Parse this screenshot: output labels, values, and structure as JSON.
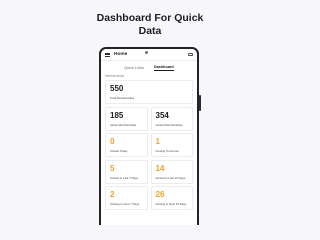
{
  "headline": {
    "line1": "Dashboard For Quick",
    "line2": "Data"
  },
  "app": {
    "title": "Home"
  },
  "tabs": [
    {
      "label": "Quick Links"
    },
    {
      "label": "Dashboard"
    }
  ],
  "section": {
    "label": "Memberships"
  },
  "stats": {
    "total": {
      "value": "550",
      "label": "Total Memberships"
    },
    "active": {
      "value": "185",
      "label": "Active Memberships"
    },
    "closed": {
      "value": "354",
      "label": "Closed Memberships"
    },
    "closed_today": {
      "value": "0",
      "label": "Closed Today"
    },
    "closing_tomorrow": {
      "value": "1",
      "label": "Closing Tomorrow"
    },
    "closed_last7": {
      "value": "5",
      "label": "Closed in Last 7 Days"
    },
    "closed_last15": {
      "value": "14",
      "label": "Closed in Last 15 Days"
    },
    "closing_next7": {
      "value": "2",
      "label": "Closing in Next 7 Days"
    },
    "closing_next15": {
      "value": "26",
      "label": "Closing in Next 15 Days"
    }
  },
  "colors": {
    "accent": "#f0a12a",
    "text": "#1e1e24",
    "frame": "#232428"
  },
  "icons": {
    "menu": "hamburger-icon",
    "topright": "window-icon"
  }
}
